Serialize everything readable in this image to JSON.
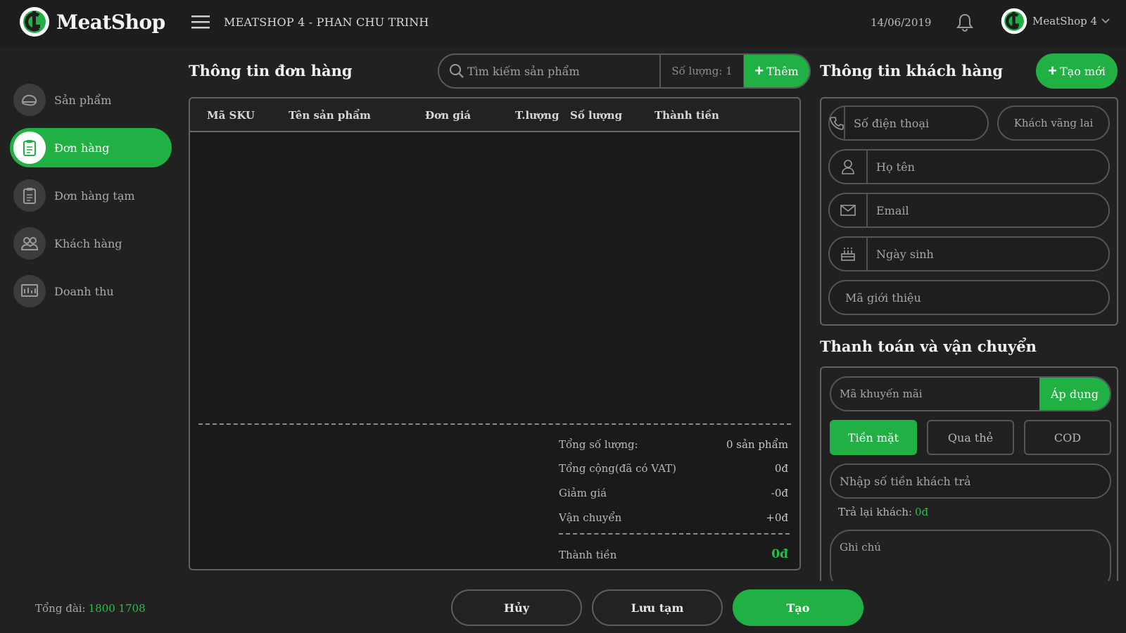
{
  "header": {
    "logo_text": "MeatShop",
    "shop_title": "MEATSHOP 4 - PHAN CHU TRINH",
    "date": "14/06/2019",
    "account_name": "MeatShop 4"
  },
  "sidebar": {
    "items": [
      {
        "label": "Sản phẩm",
        "icon": "product-icon",
        "active": false
      },
      {
        "label": "Đơn hàng",
        "icon": "order-icon",
        "active": true
      },
      {
        "label": "Đơn hàng tạm",
        "icon": "temp-order-icon",
        "active": false
      },
      {
        "label": "Khách hàng",
        "icon": "customer-icon",
        "active": false
      },
      {
        "label": "Doanh thu",
        "icon": "revenue-icon",
        "active": false
      }
    ],
    "hotline_label": "Tổng đài:",
    "hotline_number": "1800 1708"
  },
  "order": {
    "title": "Thông tin đơn hàng",
    "search_placeholder": "Tìm kiếm sản phẩm",
    "quantity_text": "Số lượng: 1",
    "add_label": "Thêm",
    "columns": [
      "Mã SKU",
      "Tên sản phẩm",
      "Đơn giá",
      "T.lượng",
      "Số lượng",
      "Thành tiền"
    ],
    "summary": {
      "total_qty_label": "Tổng số lượng:",
      "total_qty_value": "0 sản phẩm",
      "subtotal_label": "Tổng cộng(đã có VAT)",
      "subtotal_value": "0đ",
      "discount_label": "Giảm giá",
      "discount_value": "-0đ",
      "shipping_label": "Vận chuyển",
      "shipping_value": "+0đ",
      "total_label": "Thành tiền",
      "total_value": "0đ"
    }
  },
  "actions": {
    "cancel": "Hủy",
    "save_draft": "Lưu tạm",
    "create": "Tạo"
  },
  "customer": {
    "title": "Thông tin khách hàng",
    "create_new": "Tạo mới",
    "phone_placeholder": "Số điện thoại",
    "guest_label": "Khách vãng lai",
    "name_placeholder": "Họ tên",
    "email_placeholder": "Email",
    "birthday_placeholder": "Ngày sinh",
    "referral_placeholder": "Mã giới thiệu"
  },
  "payment": {
    "title": "Thanh toán và vận chuyển",
    "promo_placeholder": "Mã khuyến mãi",
    "apply_label": "Áp dụng",
    "methods": [
      "Tiền mặt",
      "Qua thẻ",
      "COD"
    ],
    "active_method": 0,
    "amount_placeholder": "Nhập số tiền khách trả",
    "change_label": "Trả lại khách:",
    "change_value": "0đ",
    "note_placeholder": "Ghi chú"
  },
  "colors": {
    "accent": "#20b043",
    "background": "#222122"
  }
}
